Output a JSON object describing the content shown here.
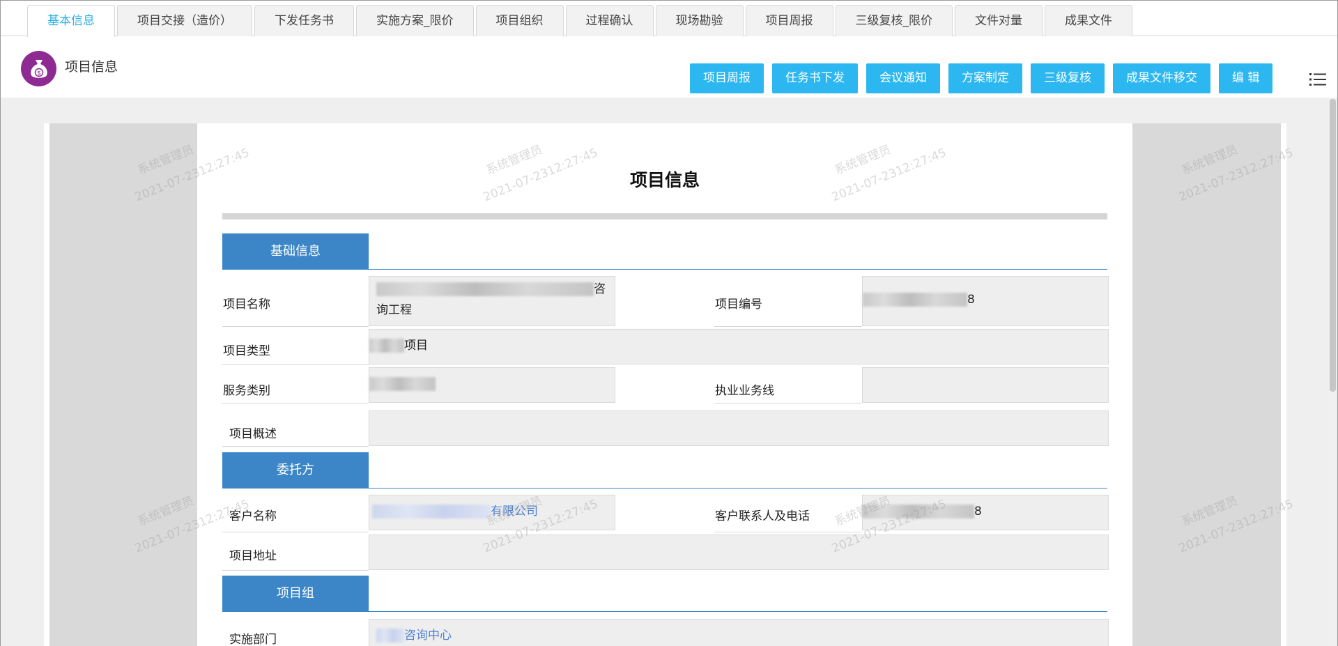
{
  "tabs": [
    {
      "label": "基本信息",
      "active": true
    },
    {
      "label": "项目交接（造价）",
      "active": false
    },
    {
      "label": "下发任务书",
      "active": false
    },
    {
      "label": "实施方案_限价",
      "active": false
    },
    {
      "label": "项目组织",
      "active": false
    },
    {
      "label": "过程确认",
      "active": false
    },
    {
      "label": "现场勘验",
      "active": false
    },
    {
      "label": "项目周报",
      "active": false
    },
    {
      "label": "三级复核_限价",
      "active": false
    },
    {
      "label": "文件对量",
      "active": false
    },
    {
      "label": "成果文件",
      "active": false
    }
  ],
  "header": {
    "title": "项目信息",
    "buttons": [
      "项目周报",
      "任务书下发",
      "会议通知",
      "方案制定",
      "三级复核",
      "成果文件移交",
      "编 辑"
    ],
    "icons": {
      "logo": "money-bag-icon",
      "menu": "list-menu-icon"
    }
  },
  "document": {
    "title": "项目信息",
    "watermark": {
      "user": "系统管理员",
      "datetime": "2021-07-2312:27:45"
    },
    "sections": {
      "basic": "基础信息",
      "client": "委托方",
      "team": "项目组"
    },
    "fields": {
      "project_name": {
        "label": "项目名称",
        "value_visible_end": "咨",
        "value_line2": "询工程"
      },
      "project_number": {
        "label": "项目编号",
        "value_visible_end": "8"
      },
      "project_type": {
        "label": "项目类型",
        "value_visible_end": "项目"
      },
      "service_category": {
        "label": "服务类别",
        "value": ""
      },
      "business_line": {
        "label": "执业业务线",
        "value": ""
      },
      "project_overview": {
        "label": "项目概述",
        "value": ""
      },
      "client_name": {
        "label": "客户名称",
        "value_visible_end": "有限公司"
      },
      "client_contact": {
        "label": "客户联系人及电话",
        "value_visible_end": "8"
      },
      "project_address": {
        "label": "项目地址",
        "value": ""
      },
      "department": {
        "label": "实施部门",
        "value_visible_end": "咨询中心"
      }
    }
  },
  "colors": {
    "accent": "#2cb7f0",
    "section": "#3c86c7",
    "tab_active": "#2eb1e4",
    "logo": "#8e2b92"
  }
}
